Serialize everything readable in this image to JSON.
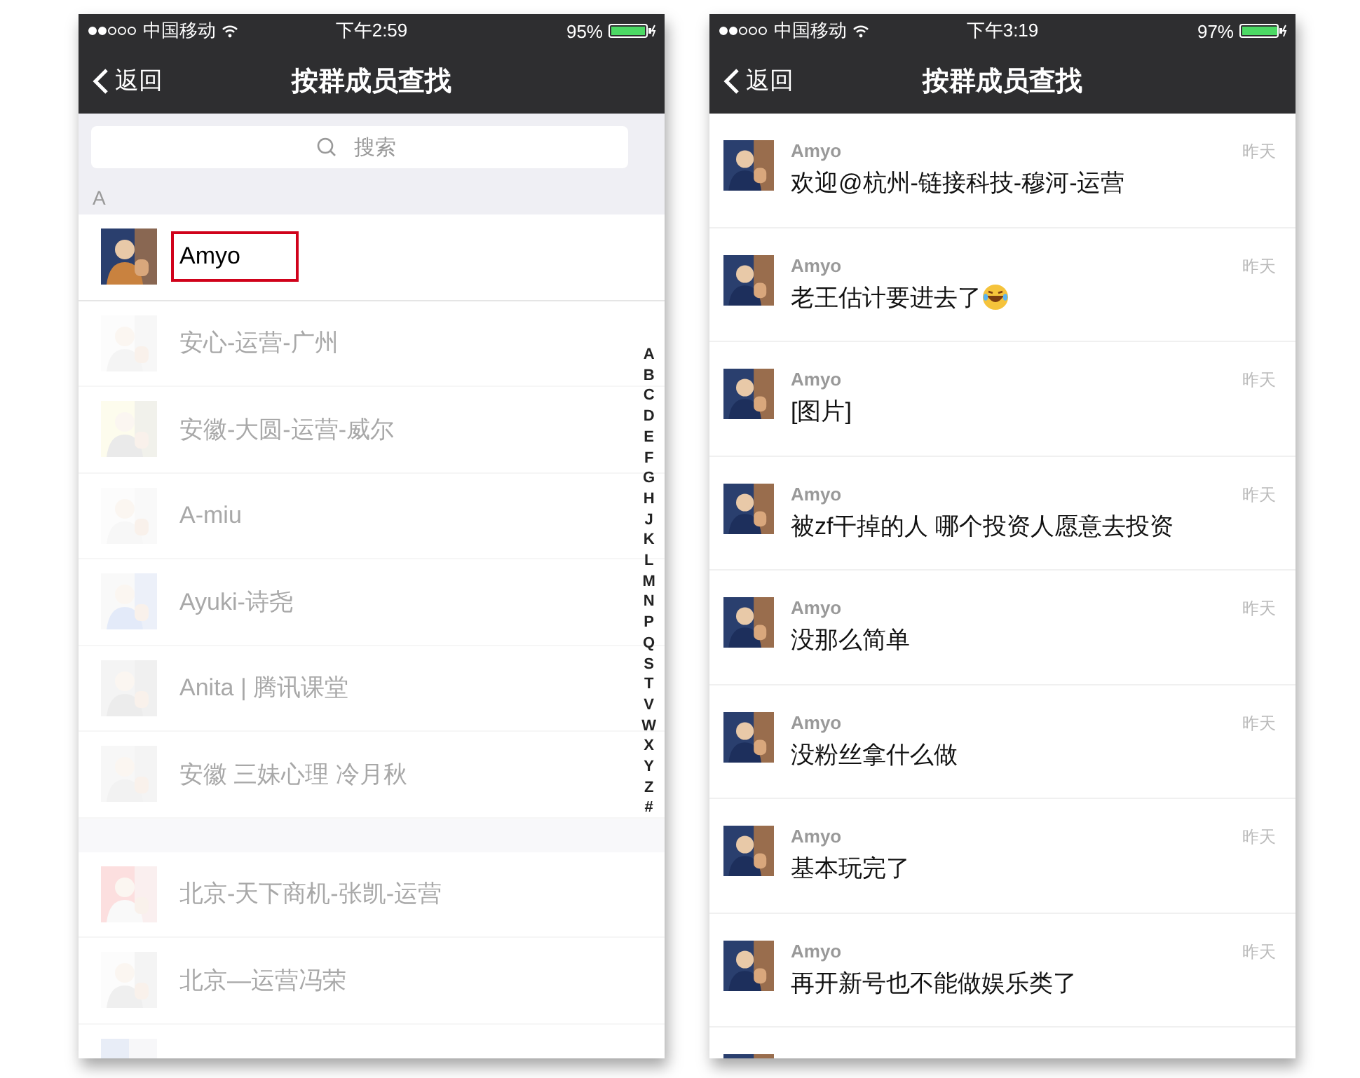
{
  "left_phone": {
    "status_bar": {
      "carrier": "中国移动",
      "time": "下午2:59",
      "battery": "95%"
    },
    "nav": {
      "back": "返回",
      "title": "按群成员查找"
    },
    "search": {
      "placeholder": "搜索"
    },
    "sections": [
      {
        "letter": "A",
        "members": [
          {
            "name": "Amyo",
            "dimmed": false,
            "highlighted": true
          },
          {
            "name": "安心-运营-广州",
            "dimmed": true,
            "highlighted": false
          },
          {
            "name": "安徽-大圆-运营-威尔",
            "dimmed": true,
            "highlighted": false
          },
          {
            "name": "A-miu",
            "dimmed": true,
            "highlighted": false
          },
          {
            "name": "Ayuki-诗尧",
            "dimmed": true,
            "highlighted": false
          },
          {
            "name": "Anita | 腾讯课堂",
            "dimmed": true,
            "highlighted": false
          },
          {
            "name": "安徽 三妹心理 冷月秋",
            "dimmed": true,
            "highlighted": false
          }
        ]
      },
      {
        "members": [
          {
            "name": "北京-天下商机-张凯-运营",
            "dimmed": true,
            "highlighted": false
          },
          {
            "name": "北京—运营冯荣",
            "dimmed": true,
            "highlighted": false
          }
        ]
      }
    ],
    "index": [
      "A",
      "B",
      "C",
      "D",
      "E",
      "F",
      "G",
      "H",
      "J",
      "K",
      "L",
      "M",
      "N",
      "P",
      "Q",
      "S",
      "T",
      "V",
      "W",
      "X",
      "Y",
      "Z",
      "#"
    ]
  },
  "right_phone": {
    "status_bar": {
      "carrier": "中国移动",
      "time": "下午3:19",
      "battery": "97%"
    },
    "nav": {
      "back": "返回",
      "title": "按群成员查找"
    },
    "messages": [
      {
        "sender": "Amyo",
        "text": "欢迎@杭州-链接科技-穆河-运营",
        "time": "昨天",
        "emoji": false
      },
      {
        "sender": "Amyo",
        "text": "老王估计要进去了",
        "time": "昨天",
        "emoji": true
      },
      {
        "sender": "Amyo",
        "text": "[图片]",
        "time": "昨天",
        "emoji": false
      },
      {
        "sender": "Amyo",
        "text": "被zf干掉的人 哪个投资人愿意去投资",
        "time": "昨天",
        "emoji": false
      },
      {
        "sender": "Amyo",
        "text": "没那么简单",
        "time": "昨天",
        "emoji": false
      },
      {
        "sender": "Amyo",
        "text": "没粉丝拿什么做",
        "time": "昨天",
        "emoji": false
      },
      {
        "sender": "Amyo",
        "text": "基本玩完了",
        "time": "昨天",
        "emoji": false
      },
      {
        "sender": "Amyo",
        "text": "再开新号也不能做娱乐类了",
        "time": "昨天",
        "emoji": false
      }
    ]
  }
}
